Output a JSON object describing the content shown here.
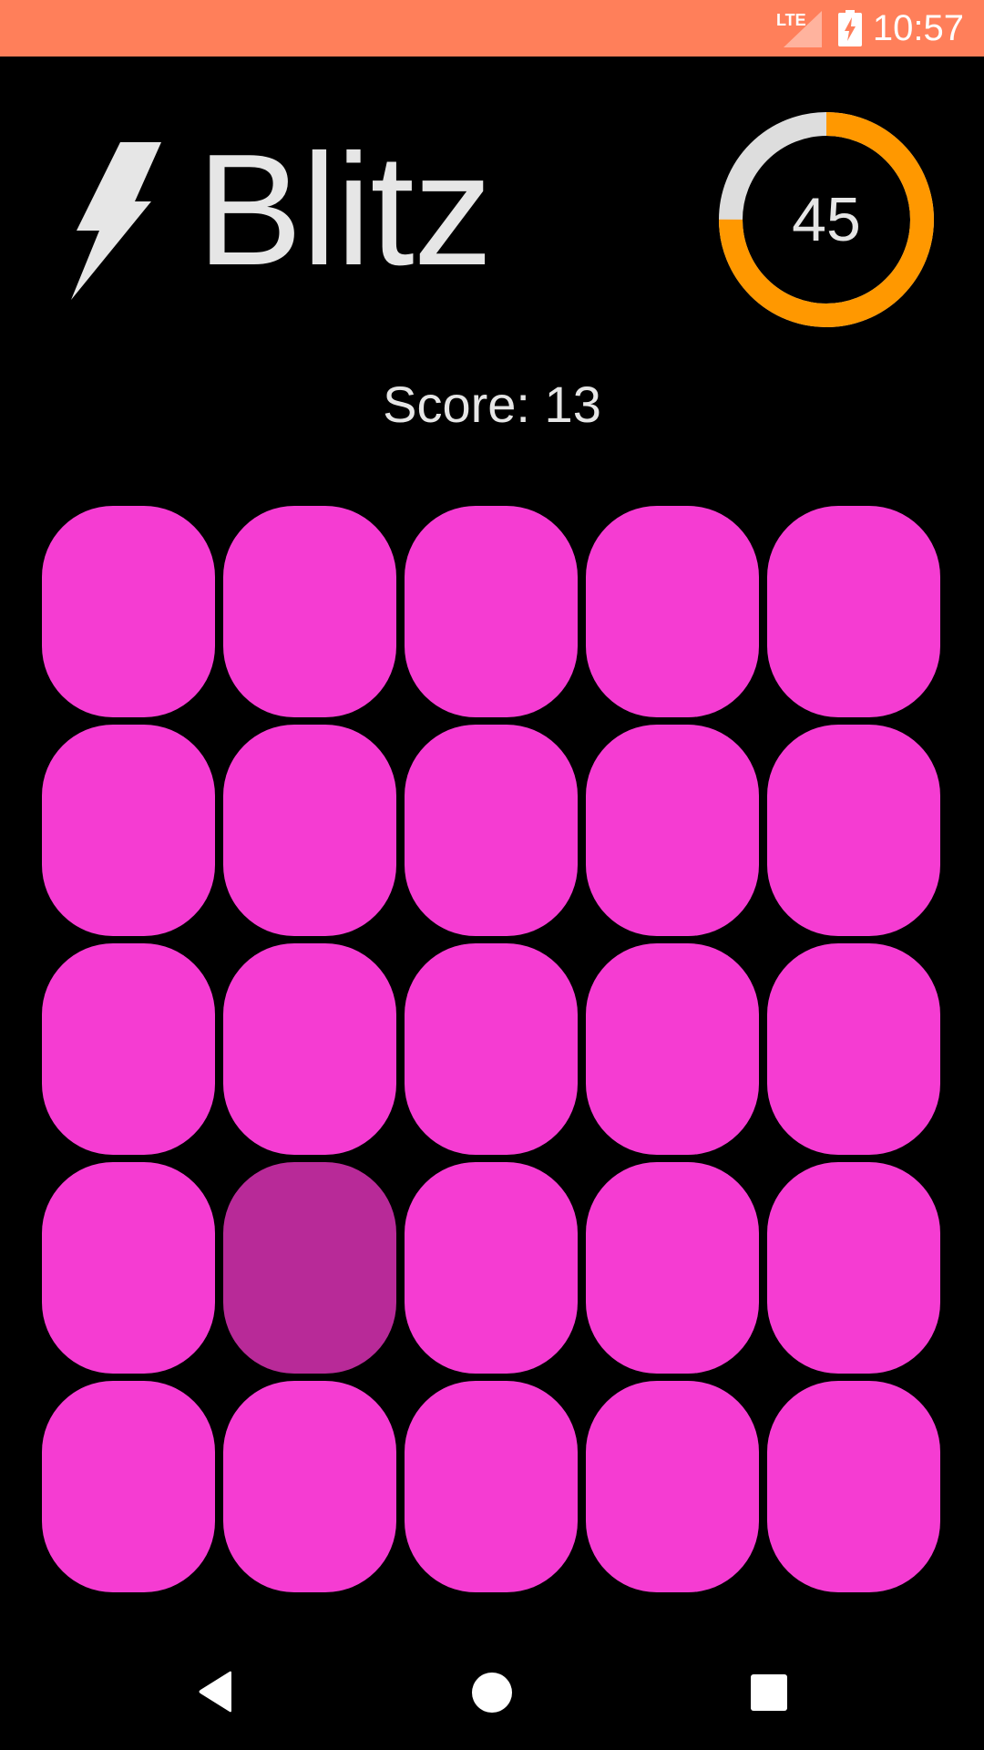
{
  "status_bar": {
    "time": "10:57",
    "network": "LTE",
    "icons": [
      "lte-signal-icon",
      "battery-charging-icon"
    ],
    "background_color": "#FF7F5A"
  },
  "header": {
    "title": "Blitz",
    "logo_icon": "lightning-bolt-icon"
  },
  "timer": {
    "value": "45",
    "remaining_fraction": 0.75,
    "track_color": "#DDDDDD",
    "progress_color": "#FF9800"
  },
  "score": {
    "text": "Score: 13"
  },
  "board": {
    "rows": 5,
    "columns": 5,
    "tile_color": "#F53CD2",
    "pressed_tile_color": "#B82A98",
    "pressed_tile": {
      "row": 4,
      "column": 2
    }
  },
  "navigation": {
    "buttons": [
      "back-icon",
      "home-icon",
      "recents-icon"
    ]
  }
}
